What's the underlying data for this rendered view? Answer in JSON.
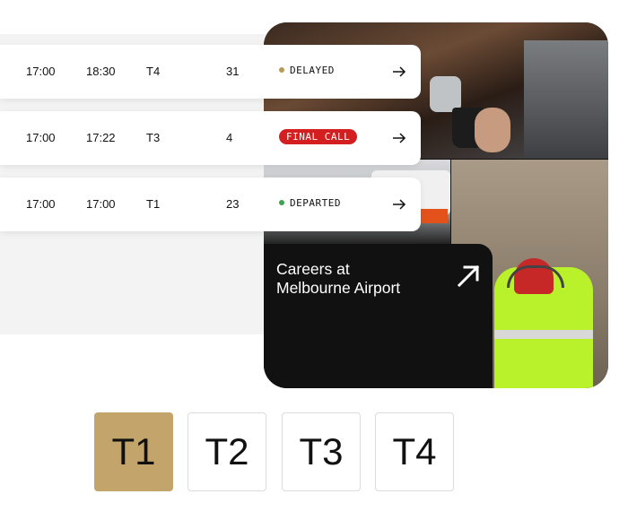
{
  "colors": {
    "delayed_dot": "#b99a55",
    "departed_dot": "#3fa34d",
    "final_call_bg": "#d31f1f",
    "active_tab": "#c3a46a"
  },
  "flights": [
    {
      "scheduled": "17:00",
      "actual": "18:30",
      "terminal": "T4",
      "gate": "31",
      "status": "DELAYED",
      "status_type": "dot-delayed"
    },
    {
      "scheduled": "17:00",
      "actual": "17:22",
      "terminal": "T3",
      "gate": "4",
      "status": "FINAL CALL",
      "status_type": "badge"
    },
    {
      "scheduled": "17:00",
      "actual": "17:00",
      "terminal": "T1",
      "gate": "23",
      "status": "DEPARTED",
      "status_type": "dot-departed"
    }
  ],
  "careers": {
    "title": "Careers at\nMelbourne Airport",
    "icon": "arrow-up-right-icon"
  },
  "terminal_tabs": [
    "T1",
    "T2",
    "T3",
    "T4"
  ],
  "active_tab": "T1"
}
